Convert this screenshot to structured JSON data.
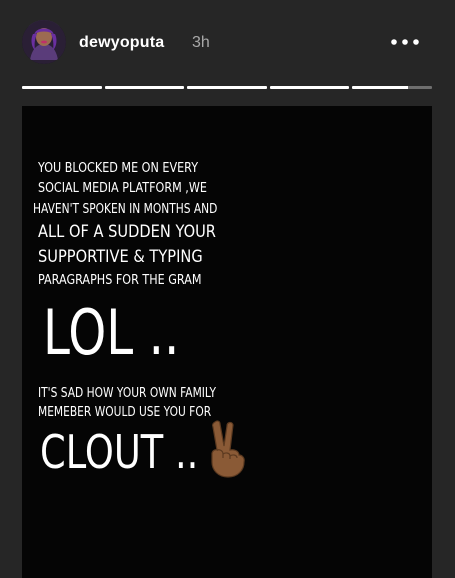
{
  "header": {
    "username": "dewyoputa",
    "time": "3h",
    "more_icon": "more-horizontal-icon",
    "avatar_icon": "avatar"
  },
  "progress": {
    "segments": 5,
    "current_segment_fill": 0.7
  },
  "story": {
    "lines": [
      "YOU BLOCKED ME ON EVERY",
      "SOCIAL MEDIA PLATFORM ,WE",
      "HAVEN'T SPOKEN IN MONTHS AND",
      "ALL OF A SUDDEN YOUR",
      "SUPPORTIVE & TYPING",
      "PARAGRAPHS FOR THE GRAM",
      "LOL ..",
      "IT'S SAD HOW YOUR OWN FAMILY",
      "MEMEBER WOULD USE YOU FOR",
      "CLOUT .."
    ],
    "emoji_icon": "victory-hand-icon",
    "colors": {
      "background": "#050505",
      "text": "#ffffff",
      "page": "#262626"
    }
  }
}
